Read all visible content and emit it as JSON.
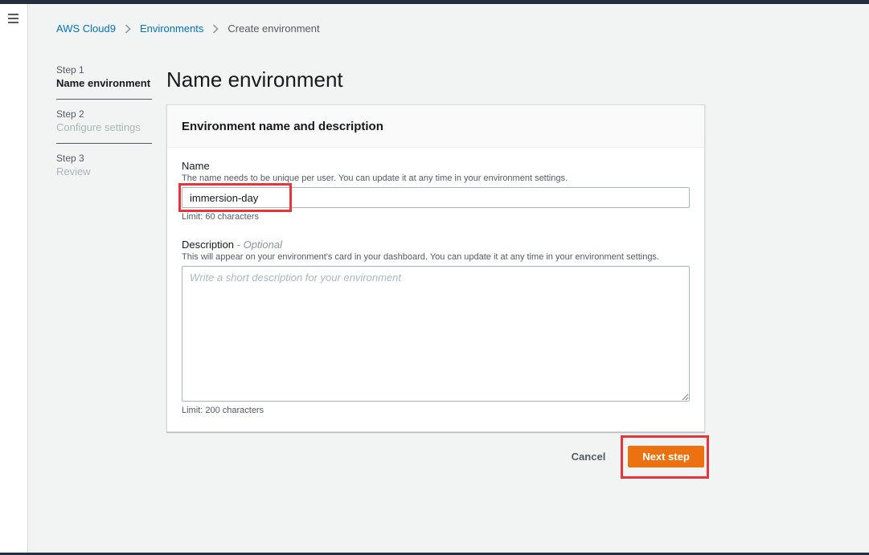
{
  "breadcrumb": {
    "items": [
      "AWS Cloud9",
      "Environments",
      "Create environment"
    ]
  },
  "steps": [
    {
      "number": "Step 1",
      "title": "Name environment",
      "state": "active"
    },
    {
      "number": "Step 2",
      "title": "Configure settings",
      "state": "inactive"
    },
    {
      "number": "Step 3",
      "title": "Review",
      "state": "inactive"
    }
  ],
  "page": {
    "title": "Name environment"
  },
  "panel": {
    "header": "Environment name and description",
    "name_field": {
      "label": "Name",
      "help": "The name needs to be unique per user. You can update it at any time in your environment settings.",
      "value": "immersion-day",
      "constraint": "Limit: 60 characters"
    },
    "description_field": {
      "label": "Description",
      "optional": " - Optional",
      "help": "This will appear on your environment's card in your dashboard. You can update it at any time in your environment settings.",
      "placeholder": "Write a short description for your environment",
      "value": "",
      "constraint": "Limit: 200 characters"
    }
  },
  "actions": {
    "cancel": "Cancel",
    "next": "Next step"
  },
  "icons": {
    "menu": "hamburger-menu-icon",
    "separator": "chevron-right-icon"
  },
  "colors": {
    "link": "#0073bb",
    "primary_button": "#ec7211",
    "highlight": "#e8353c",
    "top_bar": "#232f3e"
  }
}
